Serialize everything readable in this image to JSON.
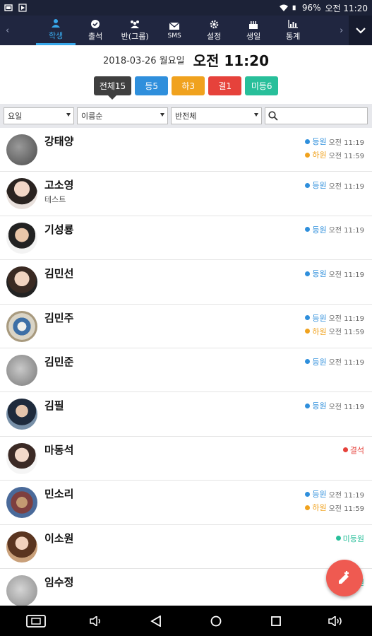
{
  "status_bar": {
    "battery": "96%",
    "time": "오전 11:20"
  },
  "tabs": [
    {
      "label": "학생",
      "icon": "user-icon",
      "active": true
    },
    {
      "label": "출석",
      "icon": "check-icon",
      "active": false
    },
    {
      "label": "반(그룹)",
      "icon": "group-icon",
      "active": false
    },
    {
      "label": "SMS",
      "icon": "mail-icon",
      "active": false
    },
    {
      "label": "설정",
      "icon": "gear-icon",
      "active": false
    },
    {
      "label": "생일",
      "icon": "cake-icon",
      "active": false
    },
    {
      "label": "통계",
      "icon": "chart-icon",
      "active": false
    }
  ],
  "header": {
    "date": "2018-03-26 월요일",
    "time": "오전 11:20"
  },
  "filters": [
    {
      "label": "전체15",
      "color": "#3f3f3f"
    },
    {
      "label": "등5",
      "color": "#2f8fdc"
    },
    {
      "label": "하3",
      "color": "#f0a21e"
    },
    {
      "label": "결1",
      "color": "#e6423b"
    },
    {
      "label": "미등6",
      "color": "#28bf9a"
    }
  ],
  "selects": {
    "day": "요일",
    "sort": "이름순",
    "class": "반전체"
  },
  "search": {
    "placeholder": ""
  },
  "students": [
    {
      "name": "강태양",
      "memo": "",
      "events": [
        {
          "type": "등원",
          "time": "오전 11:19",
          "color": "#2f8fdc"
        },
        {
          "type": "하원",
          "time": "오전 11:59",
          "color": "#f0a21e"
        }
      ]
    },
    {
      "name": "고소영",
      "memo": "테스트",
      "events": [
        {
          "type": "등원",
          "time": "오전 11:19",
          "color": "#2f8fdc"
        }
      ]
    },
    {
      "name": "기성룡",
      "memo": "",
      "events": [
        {
          "type": "등원",
          "time": "오전 11:19",
          "color": "#2f8fdc"
        }
      ]
    },
    {
      "name": "김민선",
      "memo": "",
      "events": [
        {
          "type": "등원",
          "time": "오전 11:19",
          "color": "#2f8fdc"
        }
      ]
    },
    {
      "name": "김민주",
      "memo": "",
      "events": [
        {
          "type": "등원",
          "time": "오전 11:19",
          "color": "#2f8fdc"
        },
        {
          "type": "하원",
          "time": "오전 11:59",
          "color": "#f0a21e"
        }
      ]
    },
    {
      "name": "김민준",
      "memo": "",
      "events": [
        {
          "type": "등원",
          "time": "오전 11:19",
          "color": "#2f8fdc"
        }
      ]
    },
    {
      "name": "김필",
      "memo": "",
      "events": [
        {
          "type": "등원",
          "time": "오전 11:19",
          "color": "#2f8fdc"
        }
      ]
    },
    {
      "name": "마동석",
      "memo": "",
      "events": [
        {
          "type": "결석",
          "time": "",
          "color": "#e6423b"
        }
      ]
    },
    {
      "name": "민소리",
      "memo": "",
      "events": [
        {
          "type": "등원",
          "time": "오전 11:19",
          "color": "#2f8fdc"
        },
        {
          "type": "하원",
          "time": "오전 11:59",
          "color": "#f0a21e"
        }
      ]
    },
    {
      "name": "이소원",
      "memo": "",
      "events": [
        {
          "type": "미등원",
          "time": "",
          "color": "#28bf9a"
        }
      ]
    },
    {
      "name": "임수정",
      "memo": "",
      "events": [
        {
          "type": "미등원",
          "time": "",
          "color": "#28bf9a"
        }
      ]
    }
  ],
  "fab": {
    "icon": "edit-plus-icon",
    "color": "#ef5a51"
  }
}
